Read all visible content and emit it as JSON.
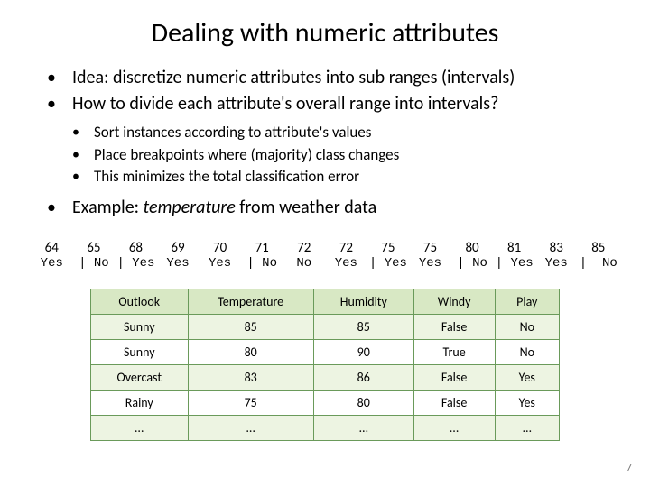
{
  "title": "Dealing with numeric attributes",
  "bullets": [
    "Idea: discretize numeric attributes into sub ranges (intervals)",
    "How to divide each attribute's overall range into intervals?"
  ],
  "sub_bullets": [
    "Sort instances according to attribute's values",
    "Place breakpoints where (majority) class changes",
    "This minimizes the total classification error"
  ],
  "example": {
    "prefix": "Example: ",
    "ital": "temperature",
    "suffix": " from weather data"
  },
  "sequence": {
    "values": [
      "64",
      "65",
      "68",
      "69",
      "70",
      "71",
      "72",
      "72",
      "75",
      "75",
      "80",
      "81",
      "83",
      "85"
    ],
    "labels": [
      "Yes",
      "| No",
      "| Yes",
      "Yes",
      "Yes",
      "| No",
      "No",
      "Yes",
      "| Yes",
      "Yes",
      "| No",
      "| Yes",
      "Yes",
      "|  No"
    ]
  },
  "chart_data": {
    "type": "table",
    "columns": [
      "Outlook",
      "Temperature",
      "Humidity",
      "Windy",
      "Play"
    ],
    "rows": [
      [
        "Sunny",
        "85",
        "85",
        "False",
        "No"
      ],
      [
        "Sunny",
        "80",
        "90",
        "True",
        "No"
      ],
      [
        "Overcast",
        "83",
        "86",
        "False",
        "Yes"
      ],
      [
        "Rainy",
        "75",
        "80",
        "False",
        "Yes"
      ],
      [
        "…",
        "…",
        "…",
        "…",
        "…"
      ]
    ]
  },
  "page_number": "7"
}
